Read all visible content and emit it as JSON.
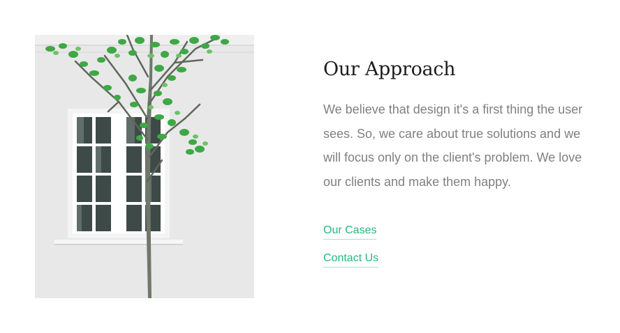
{
  "section": {
    "heading": "Our Approach",
    "body": "We believe that design it's a first thing the user sees. So, we care about true solutions and we will focus only on the client's problem. We love our clients and make them happy.",
    "links": [
      {
        "label": "Our Cases"
      },
      {
        "label": "Contact Us"
      }
    ]
  },
  "colors": {
    "accent": "#28b77e",
    "heading": "#1d1d1d",
    "body": "#808080",
    "wall": "#e7e7e7",
    "leaves": "#3fa844"
  },
  "image": {
    "subject": "white wall with window and a young tree"
  }
}
